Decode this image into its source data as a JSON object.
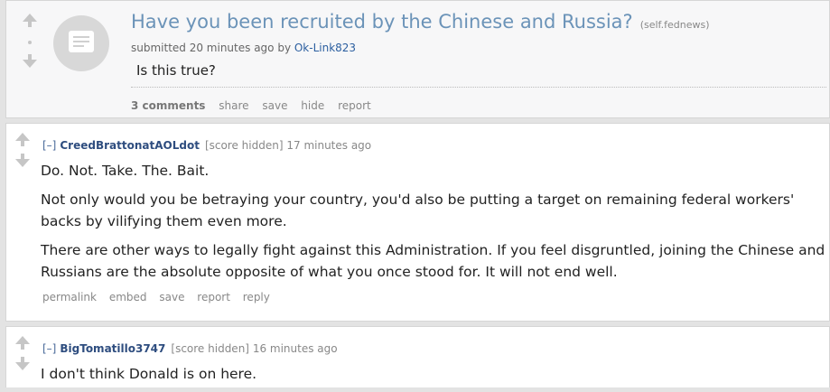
{
  "post": {
    "title": "Have you been recruited by the Chinese and Russia?",
    "domain": "(self.fednews)",
    "tagline_prefix": "submitted 20 minutes ago by ",
    "author": "Ok-Link823",
    "selftext": "Is this true?",
    "buttons": {
      "comments": "3 comments",
      "share": "share",
      "save": "save",
      "hide": "hide",
      "report": "report"
    }
  },
  "comments": [
    {
      "toggle": "[–]",
      "author": "CreedBrattonatAOLdot",
      "score": "[score hidden]",
      "time": "17 minutes ago",
      "paragraphs": [
        "Do. Not. Take. The. Bait.",
        "Not only would you be betraying your country, you'd also be putting a target on remaining federal workers' backs by vilifying them even more.",
        "There are other ways to legally fight against this Administration. If you feel disgruntled, joining the Chinese and Russians are the absolute opposite of what you once stood for. It will not end well."
      ],
      "actions": {
        "permalink": "permalink",
        "embed": "embed",
        "save": "save",
        "report": "report",
        "reply": "reply"
      }
    },
    {
      "toggle": "[–]",
      "author": "BigTomatillo3747",
      "score": "[score hidden]",
      "time": "16 minutes ago",
      "paragraphs": [
        "I don't think Donald is on here."
      ]
    }
  ],
  "icons": {
    "upvote": "up-arrow-icon",
    "downvote": "down-arrow-icon",
    "thumbnail": "self-post-icon"
  }
}
